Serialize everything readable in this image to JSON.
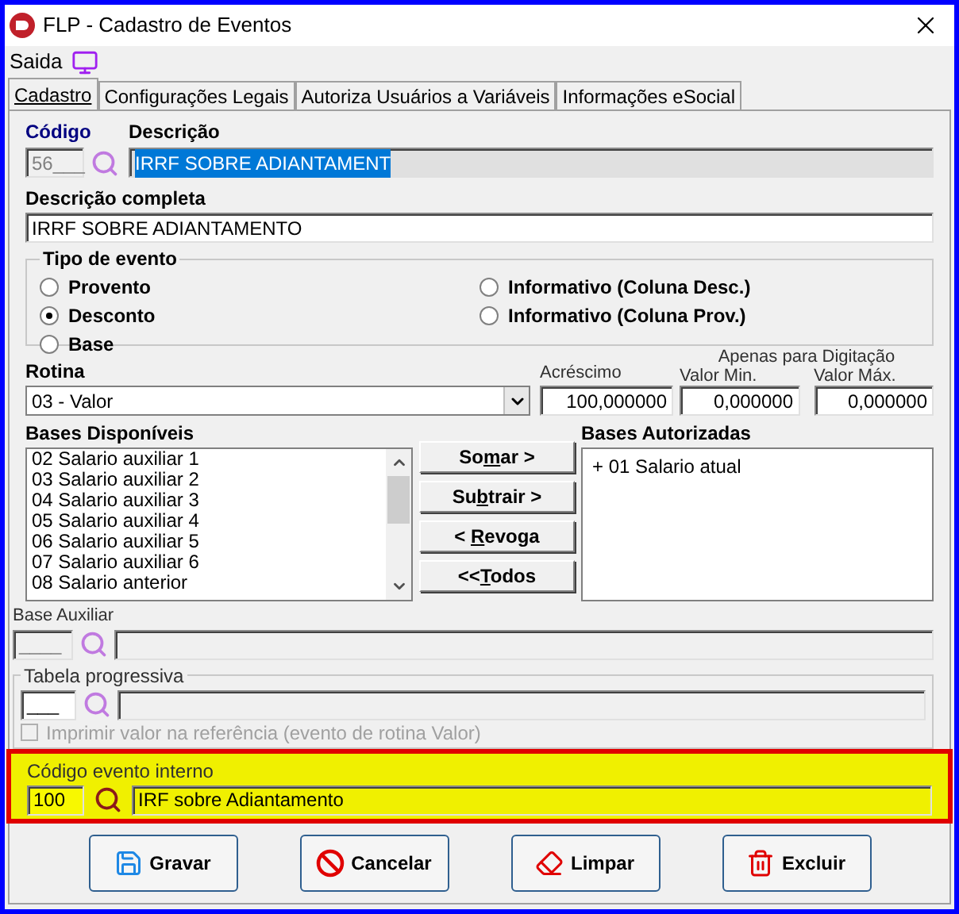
{
  "window": {
    "title": "FLP - Cadastro de Eventos"
  },
  "menu": {
    "label": "Saida"
  },
  "tabs": [
    {
      "label": "Cadastro",
      "selected": true
    },
    {
      "label": "Configurações Legais",
      "selected": false
    },
    {
      "label": "Autoriza Usuários a Variáveis",
      "selected": false
    },
    {
      "label": "Informações eSocial",
      "selected": false
    }
  ],
  "codigo": {
    "label": "Código",
    "value": "56___"
  },
  "descricao": {
    "label": "Descrição",
    "value": "IRRF SOBRE ADIANTAMENT"
  },
  "descricao_completa": {
    "label": "Descrição completa",
    "value": "IRRF SOBRE ADIANTAMENTO"
  },
  "tipo_de_evento": {
    "label": "Tipo de evento",
    "left_options": [
      {
        "label": "Provento",
        "selected": false
      },
      {
        "label": "Desconto",
        "selected": true
      },
      {
        "label": "Base",
        "selected": false
      }
    ],
    "right_options": [
      {
        "label": "Informativo (Coluna Desc.)",
        "selected": false
      },
      {
        "label": "Informativo (Coluna Prov.)",
        "selected": false
      }
    ]
  },
  "rotina": {
    "label": "Rotina",
    "value": "03 - Valor"
  },
  "acrescimo": {
    "label": "Acréscimo",
    "value": "100,000000"
  },
  "digitacao": {
    "label": "Apenas para Digitação",
    "min_label": "Valor Min.",
    "min_value": "0,000000",
    "max_label": "Valor Máx.",
    "max_value": "0,000000"
  },
  "bases_disponiveis": {
    "label": "Bases Disponíveis",
    "items": [
      "02 Salario auxiliar 1",
      "03 Salario auxiliar 2",
      "04 Salario auxiliar 3",
      "05 Salario auxiliar 4",
      "06 Salario auxiliar 5",
      "07 Salario auxiliar 6",
      "08 Salario anterior"
    ]
  },
  "actions": [
    {
      "before": "So",
      "key": "m",
      "after": "ar >"
    },
    {
      "before": "Su",
      "key": "b",
      "after": "trair >"
    },
    {
      "before": "< ",
      "key": "R",
      "after": "evoga"
    },
    {
      "before": "<<",
      "key": "T",
      "after": "odos"
    }
  ],
  "bases_autorizadas": {
    "label": "Bases Autorizadas",
    "items": [
      "+ 01 Salario atual"
    ]
  },
  "base_auxiliar": {
    "label": "Base Auxiliar",
    "value": "____"
  },
  "tabela_progressiva": {
    "label": "Tabela progressiva",
    "value": "___",
    "checkbox": {
      "label": "Imprimir valor na referência (evento de rotina Valor)",
      "checked": false,
      "disabled": true
    }
  },
  "codigo_evento_interno": {
    "label": "Código evento interno",
    "value": "100",
    "description": "IRF sobre Adiantamento",
    "highlighted": true
  },
  "buttons": [
    {
      "kind": "save",
      "label": "Gravar"
    },
    {
      "kind": "cancel",
      "label": "Cancelar"
    },
    {
      "kind": "clear",
      "label": "Limpar"
    },
    {
      "kind": "delete",
      "label": "Excluir"
    }
  ]
}
